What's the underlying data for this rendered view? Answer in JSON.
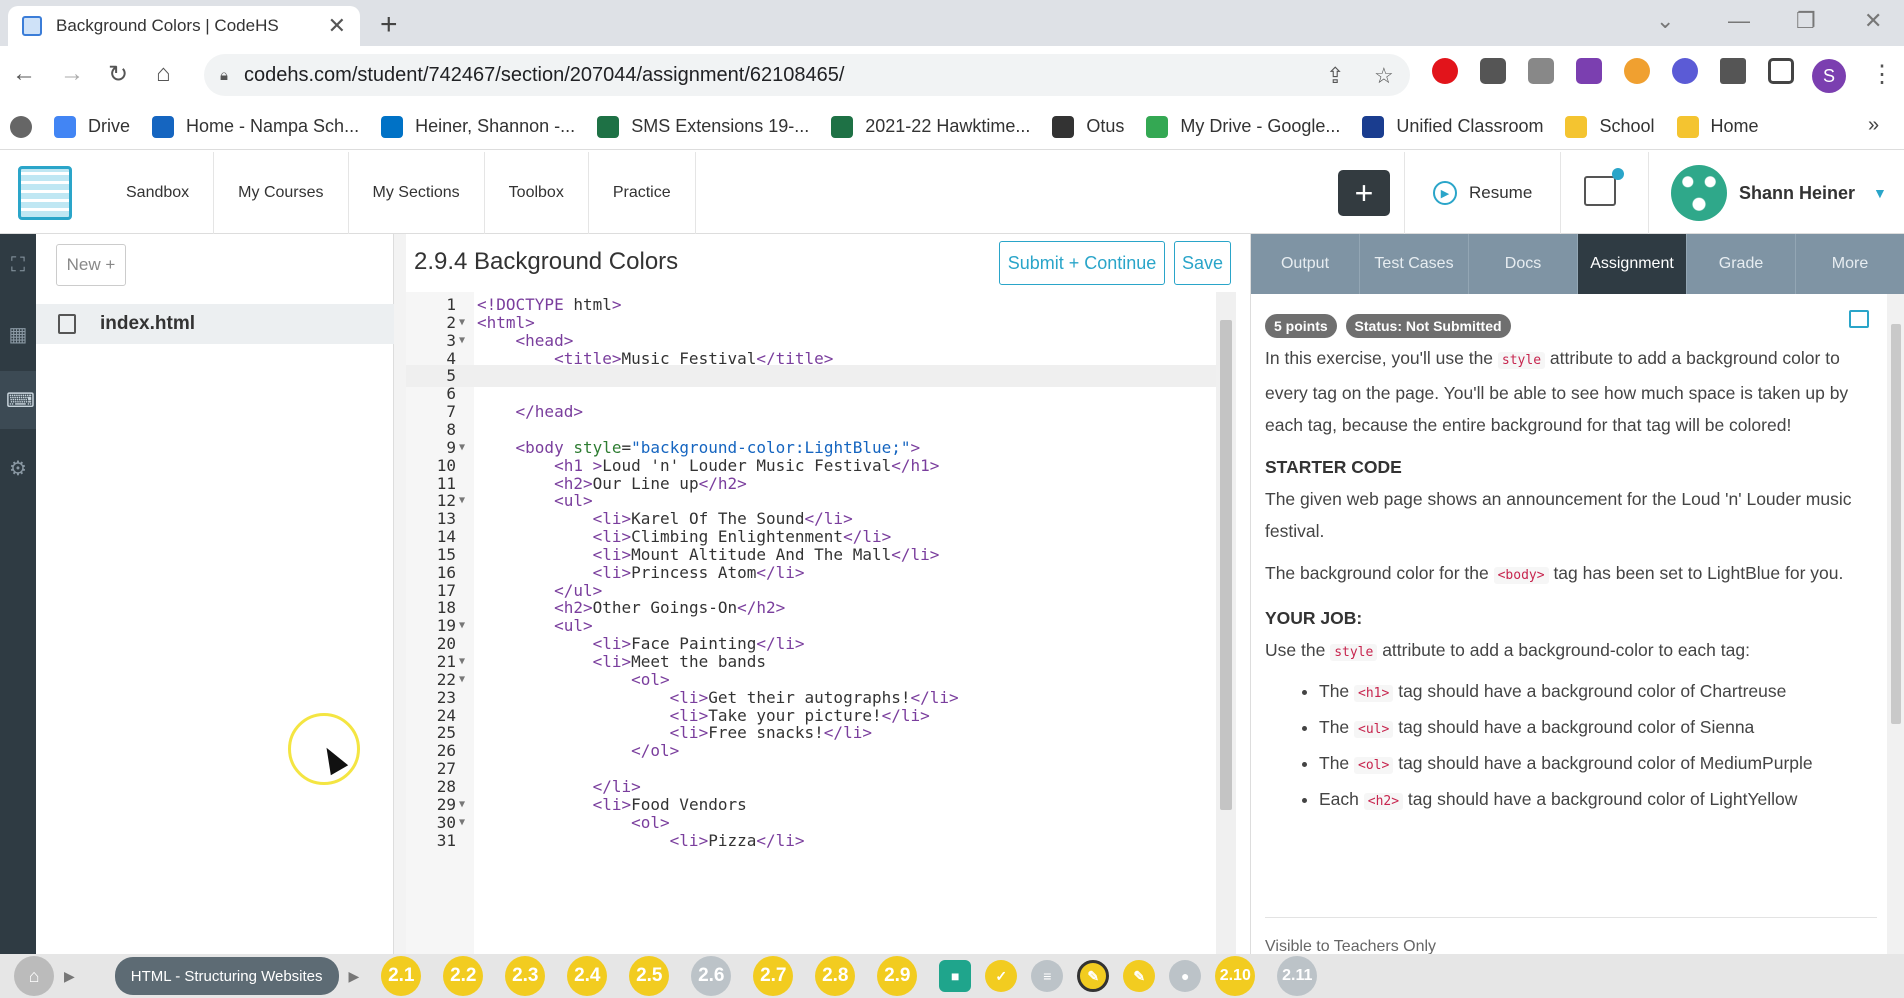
{
  "browser": {
    "tab_title": "Background Colors | CodeHS",
    "url": "codehs.com/student/742467/section/207044/assignment/62108465/",
    "profile_initial": "S",
    "bookmarks": [
      {
        "label": "Drive",
        "color": "#4285f4"
      },
      {
        "label": "Home - Nampa Sch...",
        "color": "#1565c0"
      },
      {
        "label": "Heiner, Shannon -...",
        "color": "#0072c6"
      },
      {
        "label": "SMS Extensions 19-...",
        "color": "#1e7145"
      },
      {
        "label": "2021-22 Hawktime...",
        "color": "#1e7145"
      },
      {
        "label": "Otus",
        "color": "#333333"
      },
      {
        "label": "My Drive - Google...",
        "color": "#34a853"
      },
      {
        "label": "Unified Classroom",
        "color": "#1a3d8f"
      },
      {
        "label": "School",
        "color": "#f4c430"
      },
      {
        "label": "Home",
        "color": "#f4c430"
      }
    ]
  },
  "app": {
    "nav": [
      "Sandbox",
      "My Courses",
      "My Sections",
      "Toolbox",
      "Practice"
    ],
    "resume_label": "Resume",
    "user_name": "Shann Heiner"
  },
  "files": {
    "new_label": "New +",
    "items": [
      "index.html"
    ]
  },
  "editor": {
    "title": "2.9.4 Background Colors",
    "submit_label": "Submit + Continue",
    "save_label": "Save",
    "lines": [
      {
        "n": "1",
        "fold": false,
        "text": "<!DOCTYPE html>"
      },
      {
        "n": "2",
        "fold": true,
        "text": "<html>"
      },
      {
        "n": "3",
        "fold": true,
        "text": "    <head>"
      },
      {
        "n": "4",
        "fold": false,
        "text": "        <title>Music Festival</title>"
      },
      {
        "n": "5",
        "fold": false,
        "text": ""
      },
      {
        "n": "6",
        "fold": false,
        "text": ""
      },
      {
        "n": "7",
        "fold": false,
        "text": "    </head>"
      },
      {
        "n": "8",
        "fold": false,
        "text": ""
      },
      {
        "n": "9",
        "fold": true,
        "text": "    <body style=\"background-color:LightBlue;\">"
      },
      {
        "n": "10",
        "fold": false,
        "text": "        <h1 >Loud 'n' Louder Music Festival</h1>"
      },
      {
        "n": "11",
        "fold": false,
        "text": "        <h2>Our Line up</h2>"
      },
      {
        "n": "12",
        "fold": true,
        "text": "        <ul>"
      },
      {
        "n": "13",
        "fold": false,
        "text": "            <li>Karel Of The Sound</li>"
      },
      {
        "n": "14",
        "fold": false,
        "text": "            <li>Climbing Enlightenment</li>"
      },
      {
        "n": "15",
        "fold": false,
        "text": "            <li>Mount Altitude And The Mall</li>"
      },
      {
        "n": "16",
        "fold": false,
        "text": "            <li>Princess Atom</li>"
      },
      {
        "n": "17",
        "fold": false,
        "text": "        </ul>"
      },
      {
        "n": "18",
        "fold": false,
        "text": "        <h2>Other Goings-On</h2>"
      },
      {
        "n": "19",
        "fold": true,
        "text": "        <ul>"
      },
      {
        "n": "20",
        "fold": false,
        "text": "            <li>Face Painting</li>"
      },
      {
        "n": "21",
        "fold": true,
        "text": "            <li>Meet the bands"
      },
      {
        "n": "22",
        "fold": true,
        "text": "                <ol>"
      },
      {
        "n": "23",
        "fold": false,
        "text": "                    <li>Get their autographs!</li>"
      },
      {
        "n": "24",
        "fold": false,
        "text": "                    <li>Take your picture!</li>"
      },
      {
        "n": "25",
        "fold": false,
        "text": "                    <li>Free snacks!</li>"
      },
      {
        "n": "26",
        "fold": false,
        "text": "                </ol>"
      },
      {
        "n": "27",
        "fold": false,
        "text": ""
      },
      {
        "n": "28",
        "fold": false,
        "text": "            </li>"
      },
      {
        "n": "29",
        "fold": true,
        "text": "            <li>Food Vendors"
      },
      {
        "n": "30",
        "fold": true,
        "text": "                <ol>"
      },
      {
        "n": "31",
        "fold": false,
        "text": "                    <li>Pizza</li>"
      }
    ],
    "active_line": "5"
  },
  "right_panel": {
    "tabs": [
      "Output",
      "Test Cases",
      "Docs",
      "Assignment",
      "Grade",
      "More"
    ],
    "selected_tab": "Assignment",
    "points_badge": "5 points",
    "status_badge": "Status: Not Submitted",
    "intro_a": "In this exercise, you'll use the ",
    "intro_code": "style",
    "intro_b": " attribute to add a background color to every tag on the page. You'll be able to see how much space is taken up by each tag, because the entire background for that tag will be colored!",
    "starter_heading": "STARTER CODE",
    "starter_text": "The given web page shows an announcement for the Loud 'n' Louder music festival.",
    "body_a": "The background color for the ",
    "body_code": "<body>",
    "body_b": " tag has been set to LightBlue for you.",
    "job_heading": "YOUR JOB:",
    "job_a": "Use the ",
    "job_code": "style",
    "job_b": " attribute to add a background-color to each tag:",
    "tasks": [
      {
        "pre": "The ",
        "code": "<h1>",
        "post": " tag should have a background color of Chartreuse"
      },
      {
        "pre": "The ",
        "code": "<ul>",
        "post": " tag should have a background color of Sienna"
      },
      {
        "pre": "The ",
        "code": "<ol>",
        "post": " tag should have a background color of MediumPurple"
      },
      {
        "pre": "Each ",
        "code": "<h2>",
        "post": " tag should have a background color of LightYellow"
      }
    ],
    "footer_text": "Visible to Teachers Only"
  },
  "bottom": {
    "course_label": "HTML - Structuring Websites",
    "lessons": [
      {
        "label": "2.1",
        "state": "done"
      },
      {
        "label": "2.2",
        "state": "done"
      },
      {
        "label": "2.3",
        "state": "done"
      },
      {
        "label": "2.4",
        "state": "done"
      },
      {
        "label": "2.5",
        "state": "done"
      },
      {
        "label": "2.6",
        "state": "todo"
      },
      {
        "label": "2.7",
        "state": "done"
      },
      {
        "label": "2.8",
        "state": "done"
      },
      {
        "label": "2.9",
        "state": "done"
      }
    ],
    "items": [
      {
        "icon": "video-icon",
        "state": "teal"
      },
      {
        "icon": "check-icon",
        "state": "done"
      },
      {
        "icon": "doc-icon",
        "state": "todo"
      },
      {
        "icon": "pencil-icon",
        "state": "current"
      },
      {
        "icon": "pencil-icon",
        "state": "done"
      },
      {
        "icon": "badge-icon",
        "state": "todo"
      }
    ],
    "tail": [
      {
        "label": "2.10",
        "state": "done"
      },
      {
        "label": "2.11",
        "state": "todo"
      }
    ]
  }
}
